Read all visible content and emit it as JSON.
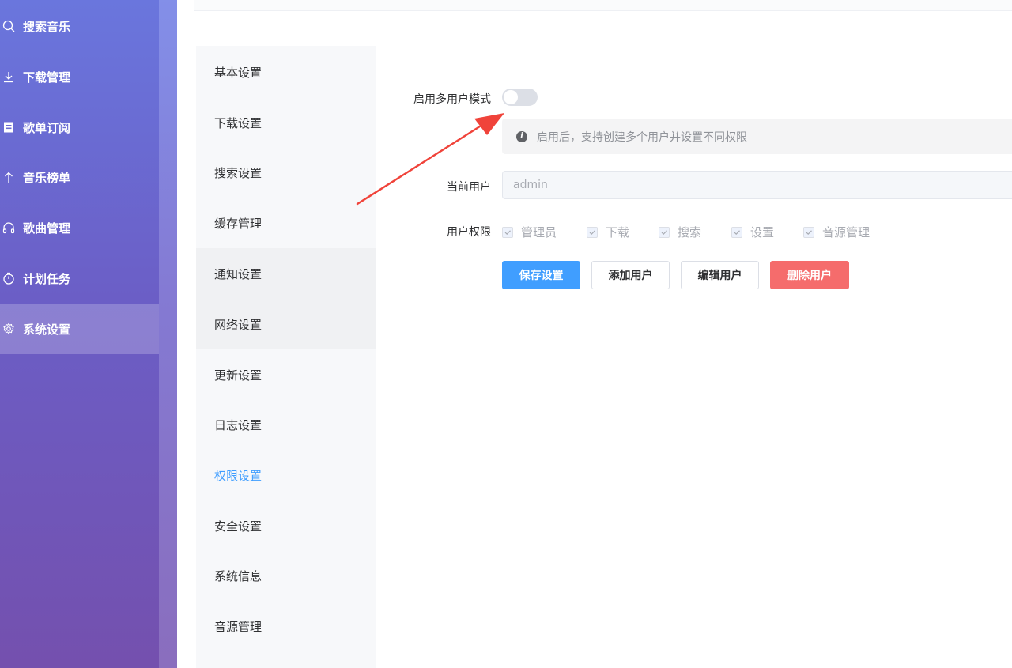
{
  "nav": {
    "items": [
      {
        "label": "搜索音乐",
        "icon": "search-icon"
      },
      {
        "label": "下载管理",
        "icon": "download-icon"
      },
      {
        "label": "歌单订阅",
        "icon": "playlist-icon"
      },
      {
        "label": "音乐榜单",
        "icon": "arrow-up-icon"
      },
      {
        "label": "歌曲管理",
        "icon": "headphones-icon"
      },
      {
        "label": "计划任务",
        "icon": "timer-icon"
      },
      {
        "label": "系统设置",
        "icon": "gear-icon"
      }
    ],
    "active_index": 6
  },
  "settings_menu": {
    "items": [
      "基本设置",
      "下载设置",
      "搜索设置",
      "缓存管理",
      "通知设置",
      "网络设置",
      "更新设置",
      "日志设置",
      "权限设置",
      "安全设置",
      "系统信息",
      "音源管理"
    ],
    "active": "权限设置"
  },
  "form": {
    "multi_user_label": "启用多用户模式",
    "multi_user_enabled": false,
    "tip_text": "启用后，支持创建多个用户并设置不同权限",
    "current_user_label": "当前用户",
    "current_user_value": "admin",
    "permissions_label": "用户权限",
    "permissions": [
      "管理员",
      "下载",
      "搜索",
      "设置",
      "音源管理"
    ]
  },
  "buttons": {
    "save": "保存设置",
    "add": "添加用户",
    "edit": "编辑用户",
    "delete": "删除用户"
  },
  "colors": {
    "primary": "#409eff",
    "danger": "#f56c6c",
    "annotation_arrow": "#f0433a"
  }
}
